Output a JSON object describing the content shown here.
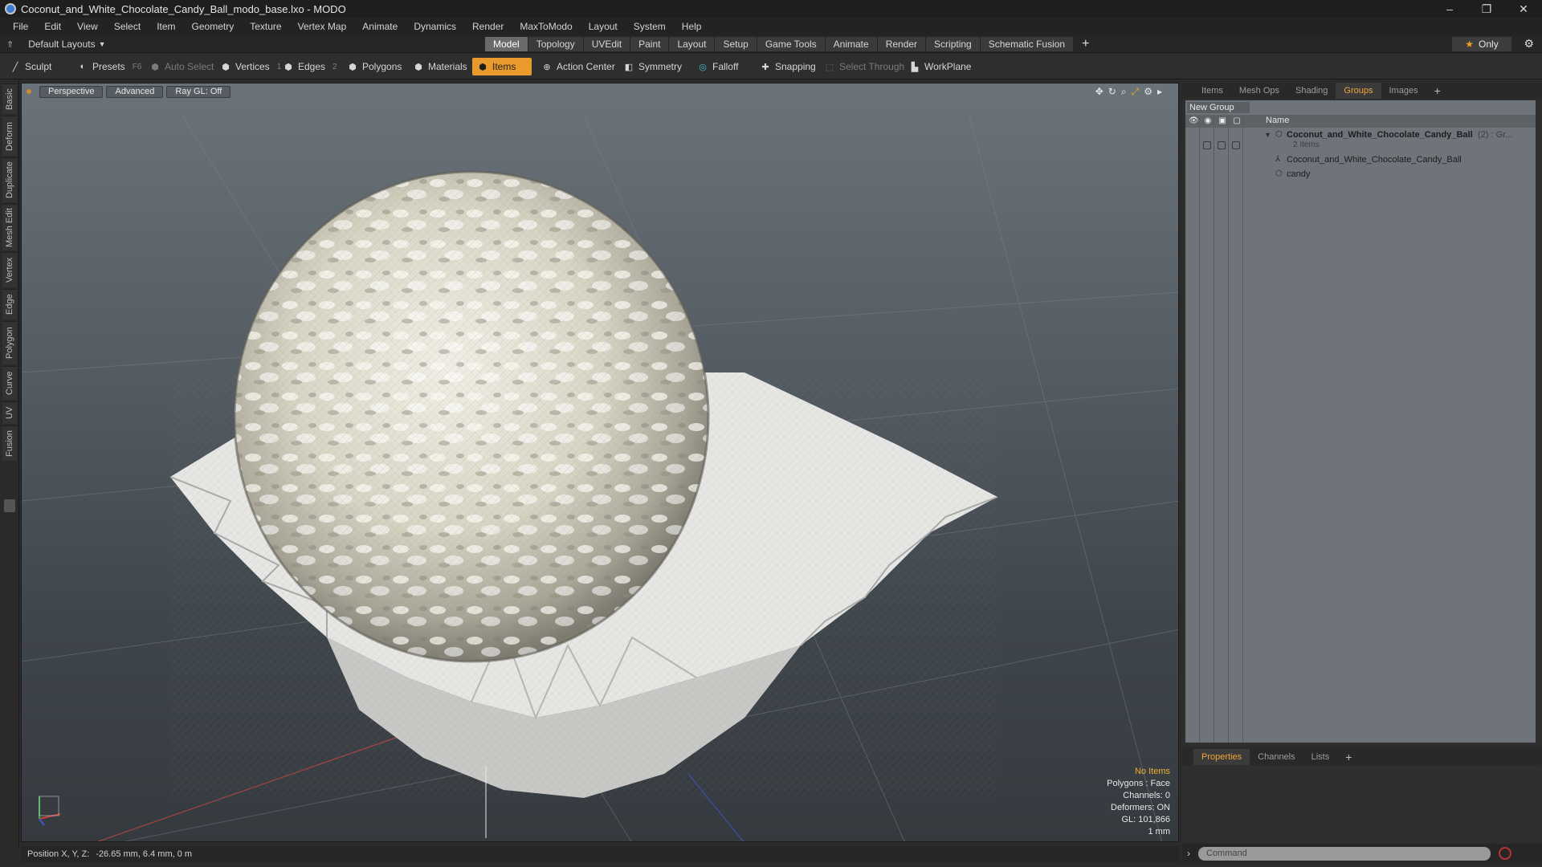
{
  "window": {
    "title": "Coconut_and_White_Chocolate_Candy_Ball_modo_base.lxo - MODO",
    "controls": [
      "–",
      "❐",
      "✕"
    ]
  },
  "menu": [
    "File",
    "Edit",
    "View",
    "Select",
    "Item",
    "Geometry",
    "Texture",
    "Vertex Map",
    "Animate",
    "Dynamics",
    "Render",
    "MaxToModo",
    "Layout",
    "System",
    "Help"
  ],
  "layoutbar": {
    "layouts_label": "Default Layouts",
    "tabs": [
      "Model",
      "Topology",
      "UVEdit",
      "Paint",
      "Layout",
      "Setup",
      "Game Tools",
      "Animate",
      "Render",
      "Scripting",
      "Schematic Fusion"
    ],
    "active_tab": "Model",
    "plus": "+",
    "only_label": "Only"
  },
  "toolbar": {
    "sculpt": "Sculpt",
    "presets": "Presets",
    "presets_hint": "F6",
    "auto_select": "Auto Select",
    "vertices": "Vertices",
    "vertices_hint": "1",
    "edges": "Edges",
    "edges_hint": "2",
    "polygons": "Polygons",
    "materials": "Materials",
    "items": "Items",
    "action_center": "Action Center",
    "symmetry": "Symmetry",
    "falloff": "Falloff",
    "snapping": "Snapping",
    "select_through": "Select Through",
    "workplane": "WorkPlane"
  },
  "left_tabs": [
    "Basic",
    "Deform",
    "Duplicate",
    "Mesh Edit",
    "Vertex",
    "Edge",
    "Polygon",
    "Curve",
    "UV",
    "Fusion"
  ],
  "viewport": {
    "view_mode": "Perspective",
    "shading": "Advanced",
    "raygl": "Ray GL: Off",
    "info": {
      "selection": "No Items",
      "polygons": "Polygons : Face",
      "channels": "Channels: 0",
      "deformers": "Deformers: ON",
      "gl": "GL: 101,866",
      "unit": "1 mm"
    }
  },
  "status": {
    "label": "Position X, Y, Z:",
    "value": "-26.65 mm, 6.4 mm, 0 m"
  },
  "groups_panel": {
    "tabs": [
      "Items",
      "Mesh Ops",
      "Shading",
      "Groups",
      "Images"
    ],
    "active_tab": "Groups",
    "new_group": "New Group",
    "column_name": "Name",
    "group": {
      "name": "Coconut_and_White_Chocolate_Candy_Ball",
      "suffix": "(2) : Gr...",
      "count": "2 Items",
      "children": [
        "Coconut_and_White_Chocolate_Candy_Ball",
        "candy"
      ]
    }
  },
  "properties_panel": {
    "tabs": [
      "Properties",
      "Channels",
      "Lists"
    ],
    "active_tab": "Properties",
    "command_placeholder": "Command"
  },
  "colors": {
    "accent": "#e89a2c",
    "active_tab_text": "#f0a63a",
    "viewport_top": "#6b737a",
    "viewport_bottom": "#353a3f"
  }
}
